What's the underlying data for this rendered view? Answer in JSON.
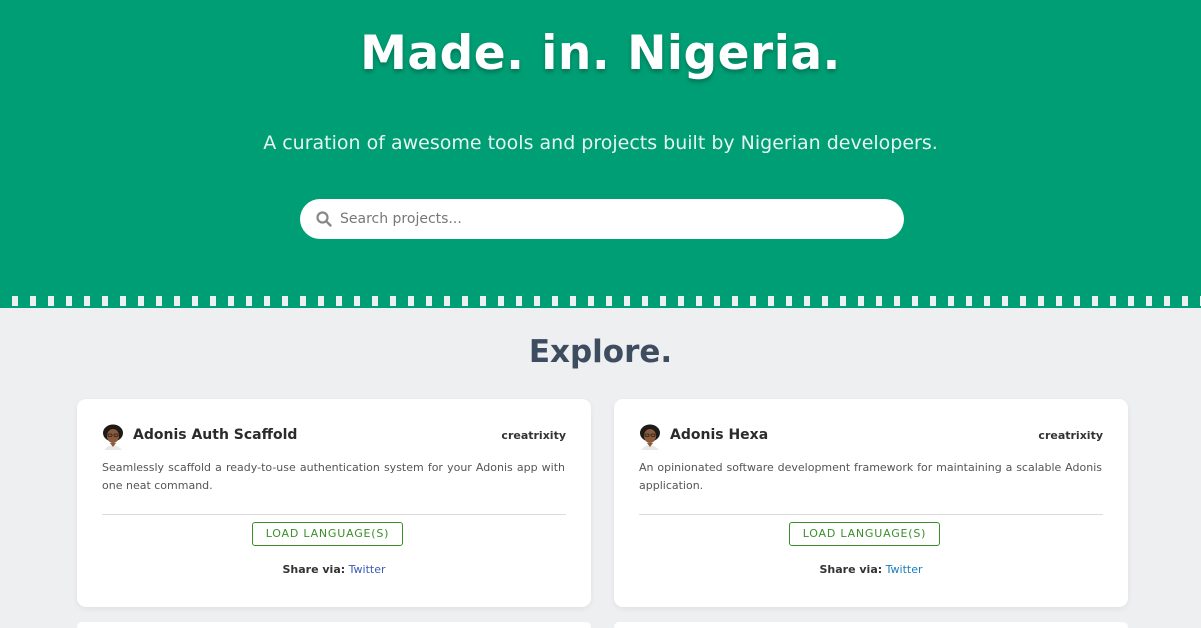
{
  "hero": {
    "title": "Made. in. Nigeria.",
    "subtitle": "A curation of awesome tools and projects built by Nigerian developers.",
    "search": {
      "placeholder": "Search projects...",
      "icon": "search-icon"
    },
    "color": "#009e74"
  },
  "explore": {
    "title": "Explore."
  },
  "projects": [
    {
      "name": "Adonis Auth Scaffold",
      "author": "creatrixity",
      "description": "Seamlessly scaffold a ready-to-use authentication system for your Adonis app with one neat command.",
      "load_label": "LOAD LANGUAGE(S)",
      "share_label": "Share via:",
      "share_link": "Twitter",
      "avatar_icon": "avatar-icon"
    },
    {
      "name": "Adonis Hexa",
      "author": "creatrixity",
      "description": "An opinionated software development framework for maintaining a scalable Adonis application.",
      "load_label": "LOAD LANGUAGE(S)",
      "share_label": "Share via:",
      "share_link": "Twitter",
      "avatar_icon": "avatar-icon"
    }
  ],
  "colors": {
    "hero_bg": "#009e74",
    "page_bg": "#eeeff0",
    "button_green": "#3a8f2a",
    "heading": "#3d4c5f"
  }
}
